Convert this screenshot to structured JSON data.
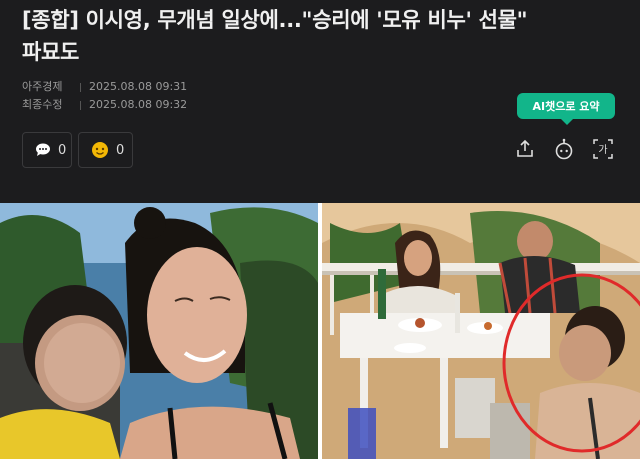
{
  "article": {
    "headline_line1": "[종합] 이시영, 무개념 일상에...\"승리에 '모유 비누' 선물\"",
    "headline_line2": "파묘도"
  },
  "meta": {
    "source": "아주경제",
    "published": "2025.08.08 09:31",
    "modified_label": "최종수정",
    "modified": "2025.08.08 09:32"
  },
  "reactions": {
    "comments": "0",
    "likes": "0"
  },
  "ai_summary": {
    "label_prefix": "AI",
    "label_rest": "챗으로 요약"
  },
  "toolbar": {
    "share": "share-icon",
    "ai": "ai-chat-icon",
    "font": "font-size-icon",
    "font_glyph": "가"
  },
  "photo": {
    "circle_color": "#e02a2a"
  }
}
